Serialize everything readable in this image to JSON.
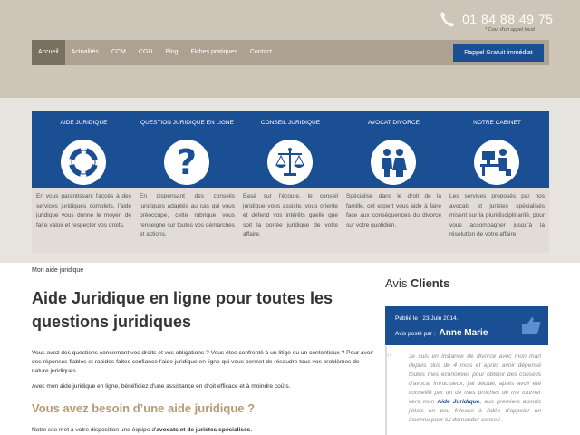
{
  "header": {
    "phone": "01 84 88 49 75",
    "phone_note": "* Cout d'un appel local",
    "cta": "Rappel Gratuit immédiat"
  },
  "nav": [
    {
      "label": "Accueil",
      "active": true
    },
    {
      "label": "Actualités"
    },
    {
      "label": "CCM"
    },
    {
      "label": "CGU"
    },
    {
      "label": "Blog"
    },
    {
      "label": "Fiches pratiques"
    },
    {
      "label": "Contact"
    }
  ],
  "cards": [
    {
      "title": "AIDE JURIDIQUE",
      "icon": "lifebuoy-icon",
      "text": "En vous garantissant l'accès à des services juridiques complets, l'aide juridique vous donne le moyen de faire valoir et respecter vos droits."
    },
    {
      "title": "QUESTION JURIDIQUE EN LIGNE",
      "icon": "question-mark-icon",
      "text": "En dispensant des conseils juridiques adaptés au cas qui vous préoccupe, cette rubrique vous renseigne sur toutes vos démarches et actions."
    },
    {
      "title": "CONSEIL JURIDIQUE",
      "icon": "scales-icon",
      "text": "Basé sur l'écoute, le conseil juridique vous assiste, vous oriente et défend vos intérêts quelle que soit la portée juridique de votre affaire."
    },
    {
      "title": "AVOCAT DIVORCE",
      "icon": "couple-icon",
      "text": "Spécialisé dans le droit de la famille, cet expert vous aide à faire face aux conséquences du divorce sur votre quotidien."
    },
    {
      "title": "NOTRE CABINET",
      "icon": "office-desk-icon",
      "text": "Les services proposés par nos avocats et juristes spécialisés misent sur la pluridisciplinarité, pour vous accompagner jusqu'à la résolution de votre affaire"
    }
  ],
  "main": {
    "breadcrumb": "Mon aide juridique",
    "title": "Aide Juridique en ligne pour toutes les questions juridiques",
    "p1": "Vous avez des questions concernant vos droits et vos obligations ? Vous êtes confronté à un litige ou un contentieux ? Pour avoir des réponses fiables et rapides faites confiance l'aide juridique en ligne qui vous permet de résoudre tous vos problèmes de nature juridiques.",
    "p2": "Avec mon aide juridique en ligne, bénéficiez d'une assistance en droit efficace et à moindre coûts.",
    "h2": "Vous avez besoin d’une aide juridique ?",
    "p3_start": "Notre site met à votre disposition une équipe d'",
    "p3_bold": "avocats et de juristes spécialisés",
    "p3_end": "."
  },
  "sidebar": {
    "title_light": "Avis",
    "title_bold": "Clients",
    "published": "Publié le : 23 Juin 2014.",
    "posted_by": "Avis posté par :",
    "author": "Anne Marie",
    "quote_start": "Je suis en instance de divorce avec mon mari depuis plus de 4 mois et après avoir dépensé toutes mes économies pour obtenir des conseils d'avocat infructueux, j'ai décidé, après avoir été conseillé par un de mes proches de me tourner vers mon ",
    "quote_strong": "Aide Juridique",
    "quote_end": ", aux premiers abords j'étais un peu frileuse à l'idée d'appeler un inconnu pour lui demander conseil ."
  },
  "colors": {
    "brand_blue": "#1b4f93",
    "header_bg": "#cdc5b8",
    "nav_bg": "#ada292",
    "accent_gold": "#b89a74"
  }
}
